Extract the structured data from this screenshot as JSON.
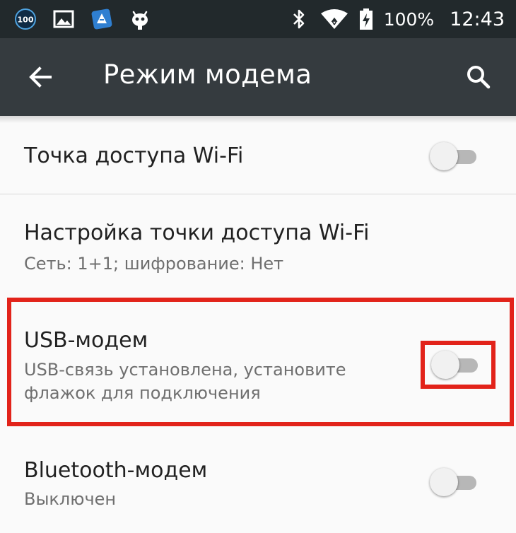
{
  "status_bar": {
    "notification_badge": "100",
    "battery_percent": "100%",
    "time": "12:43",
    "icons": [
      "badge-100-icon",
      "image-icon",
      "app-icon",
      "cyanogen-mascot-icon",
      "bluetooth-icon",
      "wifi-icon",
      "battery-charging-icon"
    ]
  },
  "app_bar": {
    "title": "Режим модема",
    "back_icon": "arrow-back-icon",
    "search_icon": "search-icon"
  },
  "settings": [
    {
      "title": "Точка доступа Wi-Fi",
      "subtitle": "",
      "switch_on": false
    },
    {
      "title": "Настройка точки доступа Wi-Fi",
      "subtitle": "Сеть: 1+1; шифрование: Нет"
    },
    {
      "title": "USB-модем",
      "subtitle_line1": "USB-связь установлена, установите",
      "subtitle_line2": "флажок для подключения",
      "switch_on": false,
      "highlighted": true
    },
    {
      "title": "Bluetooth-модем",
      "subtitle": "Выключен",
      "switch_on": false
    }
  ],
  "colors": {
    "status_bar": "#22292c",
    "app_bar": "#353b3f",
    "background": "#fafafa",
    "highlight": "#e2231a",
    "switch_track_off": "#b7b7b7",
    "switch_thumb_off": "#f1f1f1"
  }
}
